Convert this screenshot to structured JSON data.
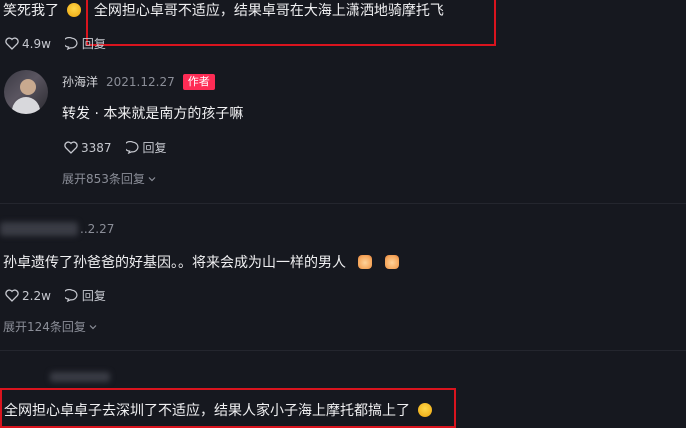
{
  "comment_top": {
    "text_prefix": "笑死我了",
    "text_highlight": "全网担心卓哥不适应，结果卓哥在大海上潇洒地骑摩托飞",
    "likes": "4.9w",
    "reply_label": "回复"
  },
  "comment_author": {
    "username": "孙海洋",
    "date": "2021.12.27",
    "badge": "作者",
    "text": "转发 · 本来就是南方的孩子嘛",
    "likes": "3387",
    "reply_label": "回复",
    "expand_label": "展开853条回复"
  },
  "comment_third": {
    "date_partial": "..2.27",
    "text": "孙卓遗传了孙爸爸的好基因。。将来会成为山一样的男人",
    "likes": "2.2w",
    "reply_label": "回复",
    "expand_label": "展开124条回复"
  },
  "comment_bottom": {
    "text_highlight": "全网担心卓卓子去深圳了不适应，结果人家小子海上摩托都搞上了"
  },
  "colors": {
    "highlight_border": "#d9141e",
    "author_badge": "#fe2c55",
    "background": "#16181f"
  }
}
